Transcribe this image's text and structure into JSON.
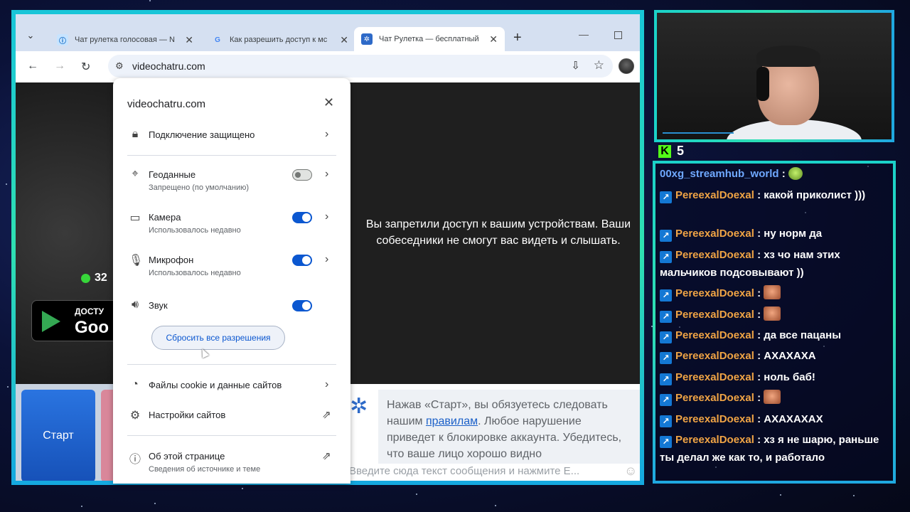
{
  "browser": {
    "tabs": [
      {
        "title": "Чат рулетка голосовая — N",
        "active": false
      },
      {
        "title": "Как разрешить доступ к мс",
        "active": false
      },
      {
        "title": "Чат Рулетка — бесплатный",
        "active": true
      }
    ],
    "new_tab_glyph": "+",
    "url": "videochatru.com"
  },
  "site_popup": {
    "domain": "videochatru.com",
    "connection": "Подключение защищено",
    "permissions": [
      {
        "label": "Геоданные",
        "sub": "Запрещено (по умолчанию)",
        "state": "off",
        "icon": "location-off-icon"
      },
      {
        "label": "Камера",
        "sub": "Использовалось недавно",
        "state": "on",
        "icon": "camera-icon"
      },
      {
        "label": "Микрофон",
        "sub": "Использовалось недавно",
        "state": "on",
        "icon": "mic-icon"
      },
      {
        "label": "Звук",
        "sub": "",
        "state": "on",
        "icon": "speaker-icon"
      }
    ],
    "reset_label": "Сбросить все разрешения",
    "cookies_label": "Файлы cookie и данные сайтов",
    "site_settings_label": "Настройки сайтов",
    "about_label": "Об этой странице",
    "about_sub": "Сведения об источнике и теме"
  },
  "page": {
    "online_count": "32",
    "gplay_small": "ДОСТУ",
    "gplay_big": "Goo",
    "deny_message": "Вы запретили доступ к вашим устройствам. Ваши собеседники не смогут вас видеть и слышать.",
    "start_label": "Старт",
    "rules_before": "Нажав «Старт», вы обязуетесь следовать нашим ",
    "rules_link": "правилам",
    "rules_after": ". Любое нарушение приведет к блокировке аккаунта. Убедитесь, что ваше лицо хорошо видно",
    "input_placeholder": "Введите сюда текст сообщения и нажмите E..."
  },
  "stream": {
    "viewer_count": "5",
    "kick_letter": "K"
  },
  "chat": [
    {
      "user": "00xg_streamhub_world",
      "text": "",
      "emote": "green",
      "first": true
    },
    {
      "user": "PereexalDoexal",
      "text": "какой приколист )))",
      "emote": ""
    },
    {
      "user": "PereexalDoexal",
      "text": "ну норм да",
      "emote": ""
    },
    {
      "user": "PereexalDoexal",
      "text": "хз чо нам этих мальчиков подсовывают ))",
      "emote": ""
    },
    {
      "user": "PereexalDoexal",
      "text": "",
      "emote": "face"
    },
    {
      "user": "PereexalDoexal",
      "text": "",
      "emote": "face"
    },
    {
      "user": "PereexalDoexal",
      "text": "да все пацаны",
      "emote": ""
    },
    {
      "user": "PereexalDoexal",
      "text": "АХАХАХА",
      "emote": ""
    },
    {
      "user": "PereexalDoexal",
      "text": "ноль баб!",
      "emote": ""
    },
    {
      "user": "PereexalDoexal",
      "text": "",
      "emote": "face"
    },
    {
      "user": "PereexalDoexal",
      "text": "АХАХАХАХ",
      "emote": ""
    },
    {
      "user": "PereexalDoexal",
      "text": "хз я не шарю, раньше ты делал же как то, и работало",
      "emote": ""
    }
  ]
}
